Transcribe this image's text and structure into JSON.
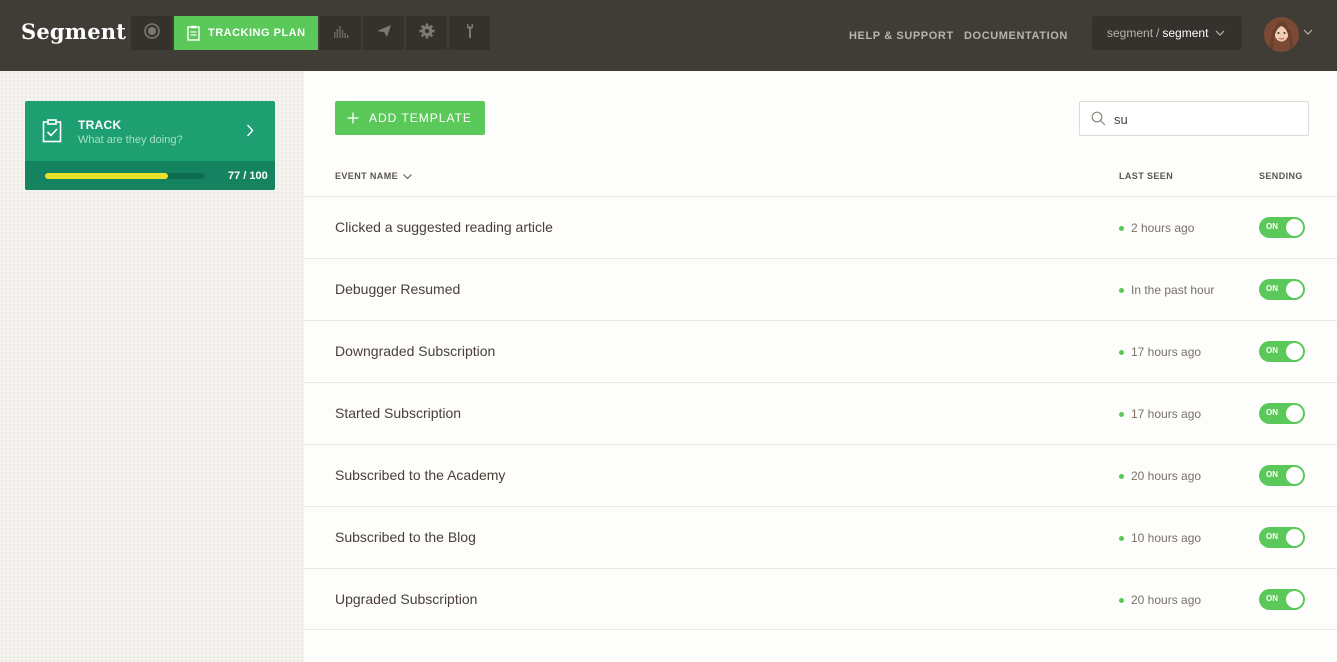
{
  "header": {
    "logo": "Segment",
    "nav": {
      "active_label": "TRACKING PLAN",
      "icons": [
        "record-icon",
        "clipboard-icon",
        "bar-chart-icon",
        "send-icon",
        "gear-icon",
        "tool-icon"
      ]
    },
    "help_label": "HELP & SUPPORT",
    "docs_label": "DOCUMENTATION",
    "workspace": {
      "org": "segment",
      "separator": "/",
      "project": "segment"
    }
  },
  "sidebar": {
    "card": {
      "title": "TRACK",
      "subtitle": "What are they doing?",
      "progress_label": "77 / 100",
      "progress_value": 77,
      "progress_max": 100
    }
  },
  "main": {
    "add_label": "ADD TEMPLATE",
    "search_value": "su",
    "columns": {
      "event_name": "EVENT NAME",
      "last_seen": "LAST SEEN",
      "sending": "SENDING"
    },
    "events": [
      {
        "name": "Clicked a suggested reading article",
        "last_seen": "2 hours ago",
        "sending": "ON"
      },
      {
        "name": "Debugger Resumed",
        "last_seen": "In the past hour",
        "sending": "ON"
      },
      {
        "name": "Downgraded Subscription",
        "last_seen": "17 hours ago",
        "sending": "ON"
      },
      {
        "name": "Started Subscription",
        "last_seen": "17 hours ago",
        "sending": "ON"
      },
      {
        "name": "Subscribed to the Academy",
        "last_seen": "20 hours ago",
        "sending": "ON"
      },
      {
        "name": "Subscribed to the Blog",
        "last_seen": "10 hours ago",
        "sending": "ON"
      },
      {
        "name": "Upgraded Subscription",
        "last_seen": "20 hours ago",
        "sending": "ON"
      }
    ]
  },
  "colors": {
    "accent": "#5bc85a",
    "topbar": "#403d37",
    "track_card": "#1d9f72",
    "progress": "#e8e32a"
  }
}
